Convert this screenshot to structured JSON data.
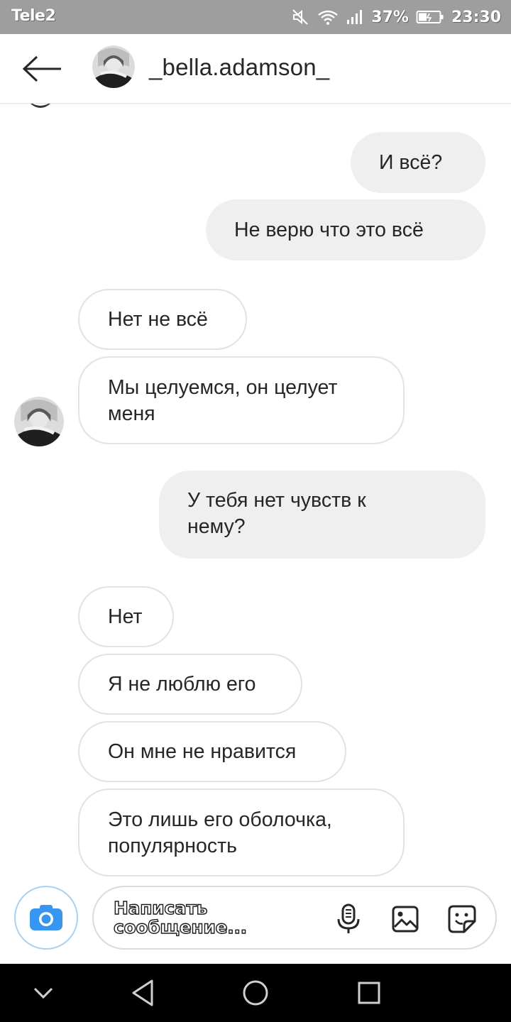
{
  "status_bar": {
    "carrier": "Tele2",
    "battery": "37%",
    "time": "23:30",
    "icons": [
      "mute-icon",
      "wifi-icon",
      "signal-icon",
      "battery-icon"
    ]
  },
  "header": {
    "back_icon": "back-arrow-icon",
    "username": "_bella.adamson_"
  },
  "messages": [
    {
      "direction": "out",
      "lines": [
        "И всё?"
      ]
    },
    {
      "direction": "out",
      "lines": [
        "Не верю что это всё"
      ]
    },
    {
      "direction": "in",
      "lines": [
        "Нет не всё"
      ]
    },
    {
      "direction": "in",
      "lines": [
        "Мы целуемся, он целует",
        "меня"
      ]
    },
    {
      "direction": "out",
      "lines": [
        "У тебя нет чувств к",
        "нему?"
      ]
    },
    {
      "direction": "in",
      "lines": [
        "Нет"
      ]
    },
    {
      "direction": "in",
      "lines": [
        "Я не люблю его"
      ]
    },
    {
      "direction": "in",
      "lines": [
        "Он мне не нравится"
      ]
    },
    {
      "direction": "in",
      "lines": [
        "Это лишь его оболочка,",
        "популярность"
      ]
    }
  ],
  "composer": {
    "placeholder_line1": "Написать",
    "placeholder_line2": "сообщение...",
    "icons": [
      "camera-icon",
      "microphone-icon",
      "gallery-icon",
      "sticker-icon"
    ]
  },
  "nav": {
    "icons": [
      "chevron-down-icon",
      "back-triangle-icon",
      "home-circle-icon",
      "recents-square-icon"
    ]
  },
  "colors": {
    "outgoing_bubble": "#efefef",
    "incoming_border": "#e2e2e2",
    "camera_accent": "#3797f0",
    "status_bar": "#9e9e9e",
    "nav_bar": "#000000"
  }
}
